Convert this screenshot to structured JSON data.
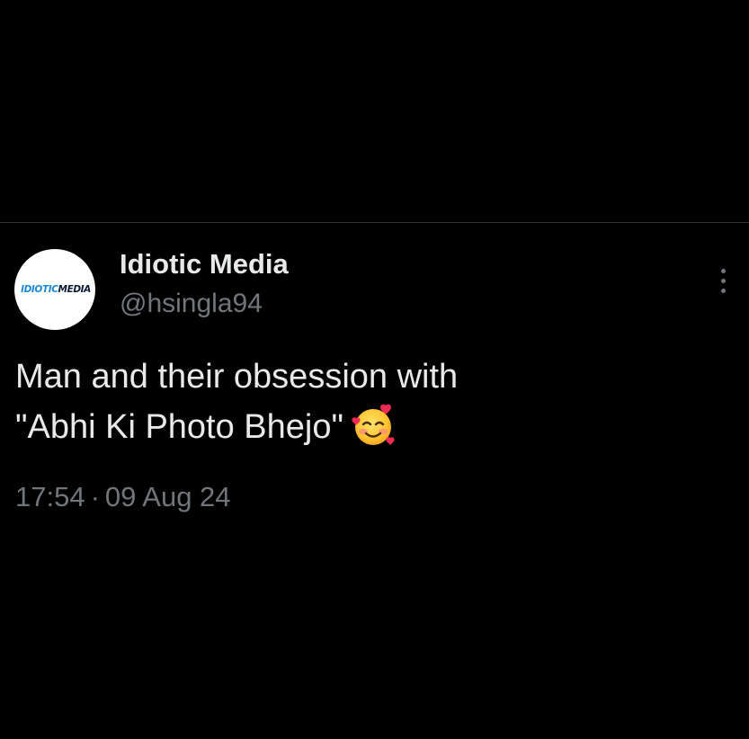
{
  "tweet": {
    "author": {
      "display_name": "Idiotic Media",
      "handle": "@hsingla94",
      "avatar_logo_part1": "IDIOTIC",
      "avatar_logo_part2": "MEDIA"
    },
    "text_line1": "Man and their obsession with",
    "text_line2": "\"Abhi Ki Photo Bhejo\"",
    "emoji": "smiling-face-with-hearts-emoji",
    "time": "17:54",
    "separator": "·",
    "date": "09 Aug 24",
    "more_icon": "more-vertical-icon"
  },
  "colors": {
    "background": "#000000",
    "primary_text": "#e7e9ea",
    "secondary_text": "#71767b",
    "divider": "#2f3336",
    "logo_blue": "#1e88d8",
    "logo_navy": "#0d1b3a"
  }
}
